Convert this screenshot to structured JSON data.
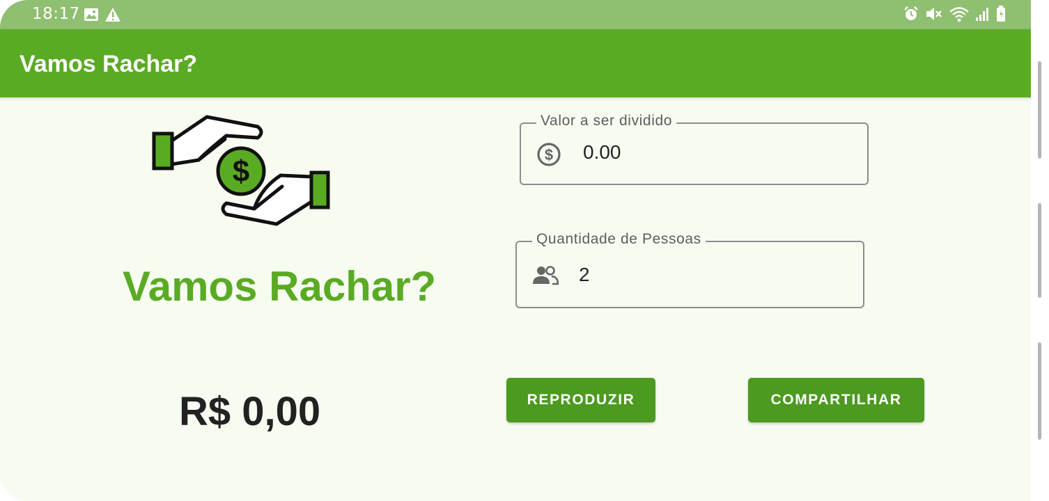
{
  "status_bar": {
    "time": "18:17",
    "left_icons": [
      "image-icon",
      "warning-icon"
    ],
    "right_icons": [
      "alarm-icon",
      "mute-icon",
      "wifi-icon",
      "signal-icon",
      "battery-icon"
    ]
  },
  "app_bar": {
    "title": "Vamos Rachar?"
  },
  "main": {
    "logo_icon": "money-hands-icon",
    "headline": "Vamos Rachar?",
    "result": "R$ 0,00"
  },
  "form": {
    "valor": {
      "label": "Valor a ser dividido",
      "value": "0.00",
      "icon": "dollar-circle-icon"
    },
    "quantidade": {
      "label": "Quantidade de Pessoas",
      "value": "2",
      "icon": "people-icon"
    }
  },
  "buttons": {
    "reproduzir": "REPRODUZIR",
    "compartilhar": "COMPARTILHAR"
  },
  "colors": {
    "primary": "#5aab24",
    "button": "#4c9a1f",
    "status_bar": "#8fbf70",
    "background": "#f7fcf1",
    "text_dark": "#222222"
  }
}
